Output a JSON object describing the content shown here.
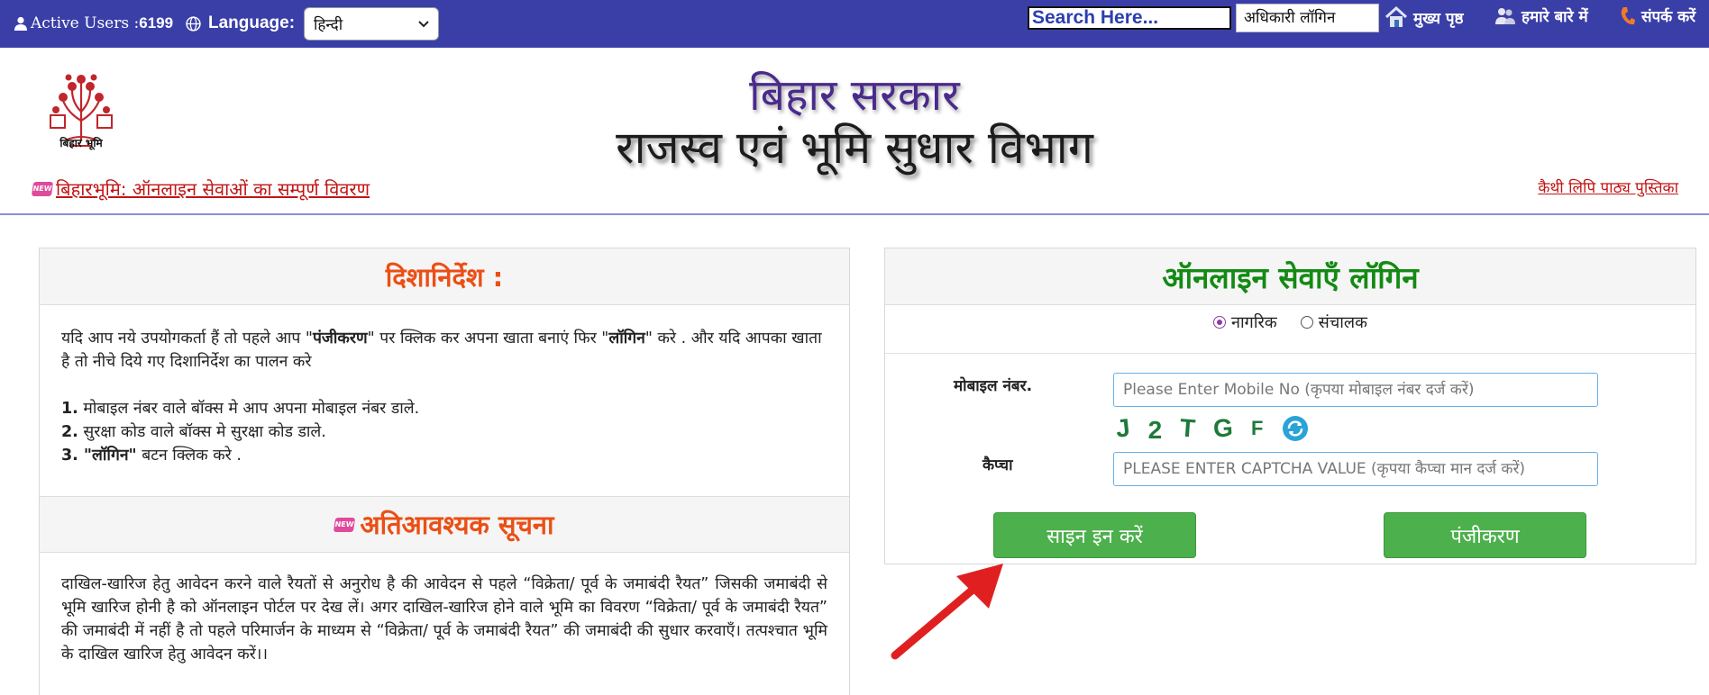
{
  "topbar": {
    "active_users_label": "Active Users :",
    "active_users_count": "6199",
    "language_label": "Language:",
    "language_selected": "हिन्दी",
    "search_placeholder": "Search Here...",
    "officer_login": "अधिकारी लॉगिन",
    "nav": {
      "home": "मुख्य पृष्ठ",
      "about": "हमारे बारे में",
      "contact": "संपर्क करें"
    }
  },
  "header": {
    "logo_text": "बिहार भूमि",
    "title_line1": "बिहार सरकार",
    "title_line2": "राजस्व एवं भूमि सुधार विभाग",
    "info_link": "बिहारभूमि: ऑनलाइन सेवाओं का सम्पूर्ण विवरण",
    "kaithi_link": "कैथी लिपि पाठ्य पुस्तिका",
    "new_badge": "NEW"
  },
  "guidelines": {
    "title": "दिशानिर्देश :",
    "intro_pre": "यदि आप नये उपयोगकर्ता हैं तो पहले आप \"",
    "intro_b1": "पंजीकरण",
    "intro_mid": "\" पर क्लिक कर अपना खाता बनाएं फिर \"",
    "intro_b2": "लॉगिन",
    "intro_post": "\" करे . और यदि आपका खाता है तो नीचे दिये गए दिशानिर्देश का पालन करे",
    "steps": [
      {
        "num": "1.",
        "text": " मोबाइल नंबर वाले बॉक्स मे आप अपना मोबाइल नंबर डाले."
      },
      {
        "num": "2.",
        "text": " सुरक्षा कोड वाले बॉक्स मे सुरक्षा कोड डाले."
      },
      {
        "num": "3.",
        "bold": " \"लॉगिन\"",
        "text": " बटन क्लिक करे ."
      }
    ]
  },
  "notice": {
    "title": "अतिआवश्यक सूचना",
    "body": "दाखिल-खारिज हेतु आवेदन करने वाले रैयतों से अनुरोध है की आवेदन से पहले “विक्रेता/ पूर्व के जमाबंदी रैयत” जिसकी जमाबंदी से भूमि खारिज होनी है को ऑनलाइन पोर्टल पर देख लें। अगर दाखिल-खारिज होने वाले भूमि का विवरण “विक्रेता/ पूर्व के जमाबंदी रैयत” की जमाबंदी में नहीं है तो पहले परिमार्जन के माध्यम से “विक्रेता/ पूर्व के जमाबंदी रैयत” की जमाबंदी की सुधार करवाएँ। तत्पश्चात भूमि के दाखिल खारिज हेतु आवेदन करें।।"
  },
  "login": {
    "title": "ऑनलाइन सेवाएँ लॉगिन",
    "radio_citizen": "नागरिक",
    "radio_operator": "संचालक",
    "selected_role": "नागरिक",
    "mobile_label": "मोबाइल नंबर.",
    "mobile_placeholder": "Please Enter Mobile No (कृपया मोबाइल नंबर दर्ज करें)",
    "captcha_label": "कैप्चा",
    "captcha_chars": [
      "J",
      "2",
      "T",
      "G",
      "F"
    ],
    "captcha_placeholder": "PLEASE ENTER CAPTCHA VALUE (कृपया कैप्चा मान दर्ज करें)",
    "signin_button": "साइन इन करें",
    "register_button": "पंजीकरण"
  },
  "colors": {
    "topbar": "#3a3fa8",
    "accent_orange": "#ea4f15",
    "login_green": "#138a13",
    "button_green": "#4cb04c",
    "link_red": "#c21414",
    "arrow_red": "#e02020"
  }
}
